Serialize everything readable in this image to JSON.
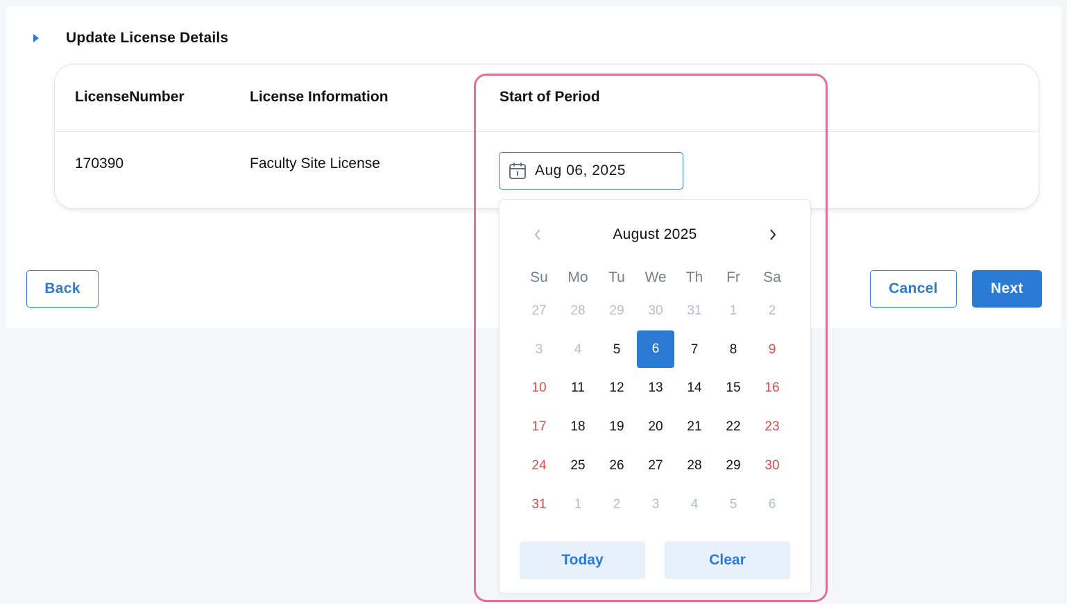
{
  "section": {
    "title": "Update License Details"
  },
  "table": {
    "headers": [
      "LicenseNumber",
      "License Information",
      "Start of Period"
    ],
    "row": {
      "license_number": "170390",
      "license_information": "Faculty Site License"
    }
  },
  "date_input": {
    "value": "Aug 06, 2025",
    "icon": "calendar-icon"
  },
  "calendar": {
    "month_label": "August 2025",
    "weekdays": [
      "Su",
      "Mo",
      "Tu",
      "We",
      "Th",
      "Fr",
      "Sa"
    ],
    "weeks": [
      [
        "27",
        "28",
        "29",
        "30",
        "31",
        "1",
        "2"
      ],
      [
        "3",
        "4",
        "5",
        "6",
        "7",
        "8",
        "9"
      ],
      [
        "10",
        "11",
        "12",
        "13",
        "14",
        "15",
        "16"
      ],
      [
        "17",
        "18",
        "19",
        "20",
        "21",
        "22",
        "23"
      ],
      [
        "24",
        "25",
        "26",
        "27",
        "28",
        "29",
        "30"
      ],
      [
        "31",
        "1",
        "2",
        "3",
        "4",
        "5",
        "6"
      ]
    ],
    "selected_day": "6",
    "today_label": "Today",
    "clear_label": "Clear"
  },
  "buttons": {
    "back": "Back",
    "cancel": "Cancel",
    "next": "Next"
  },
  "colors": {
    "accent": "#2b7ad3",
    "weekend": "#e14a4a",
    "highlight": "#e0709a"
  }
}
